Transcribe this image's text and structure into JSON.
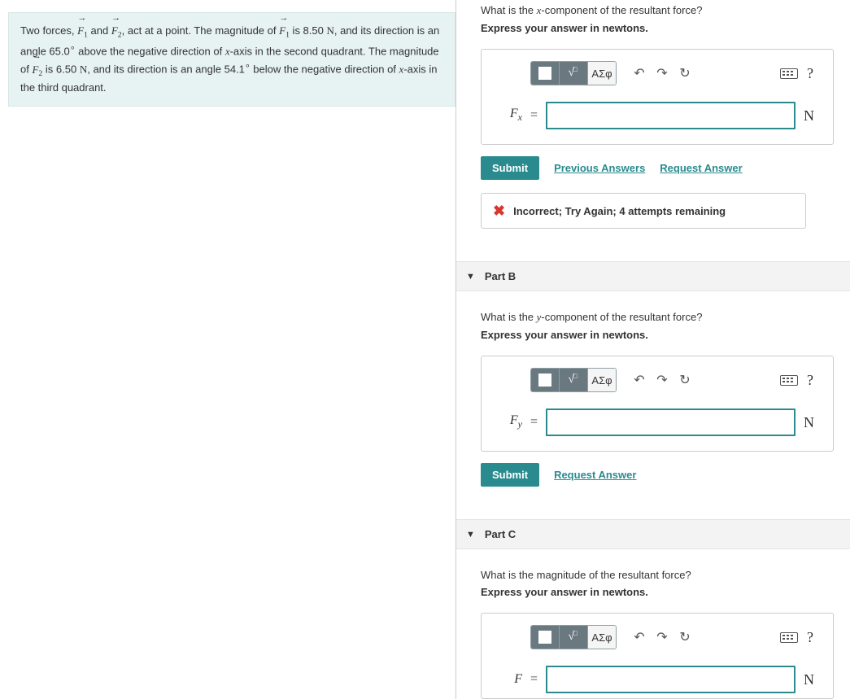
{
  "problem": {
    "t1": "Two forces, ",
    "f1": "F",
    "s1": "1",
    "t2": " and ",
    "f2": "F",
    "s2": "2",
    "t3": ", act at a point. The magnitude of ",
    "t4": " is 8.50 ",
    "N1": "N",
    "t5": ", and its direction is an angle 65.0",
    "deg": "∘",
    "t6": " above the negative direction of ",
    "xvar": "x",
    "t7": "-axis in the second quadrant. The magnitude of ",
    "t8": " is 6.50 ",
    "N2": "N",
    "t9": ", and its direction is an angle 54.1",
    "t10": " below the negative direction of ",
    "t11": "-axis in the third quadrant."
  },
  "toolbar": {
    "greek": "ΑΣφ",
    "help": "?"
  },
  "parts": {
    "a": {
      "question": "What is the x-component of the resultant force?",
      "hint": "Express your answer in newtons.",
      "var_html": "F<sub>x</sub>",
      "unit": "N",
      "value": "",
      "submit": "Submit",
      "prev": "Previous Answers",
      "req": "Request Answer",
      "feedback": "Incorrect; Try Again; 4 attempts remaining"
    },
    "b": {
      "title": "Part B",
      "question": "What is the y-component of the resultant force?",
      "hint": "Express your answer in newtons.",
      "var_html": "F<sub>y</sub>",
      "unit": "N",
      "value": "",
      "submit": "Submit",
      "req": "Request Answer"
    },
    "c": {
      "title": "Part C",
      "question": "What is the magnitude of the resultant force?",
      "hint": "Express your answer in newtons.",
      "var_html": "F",
      "unit": "N",
      "value": ""
    }
  }
}
